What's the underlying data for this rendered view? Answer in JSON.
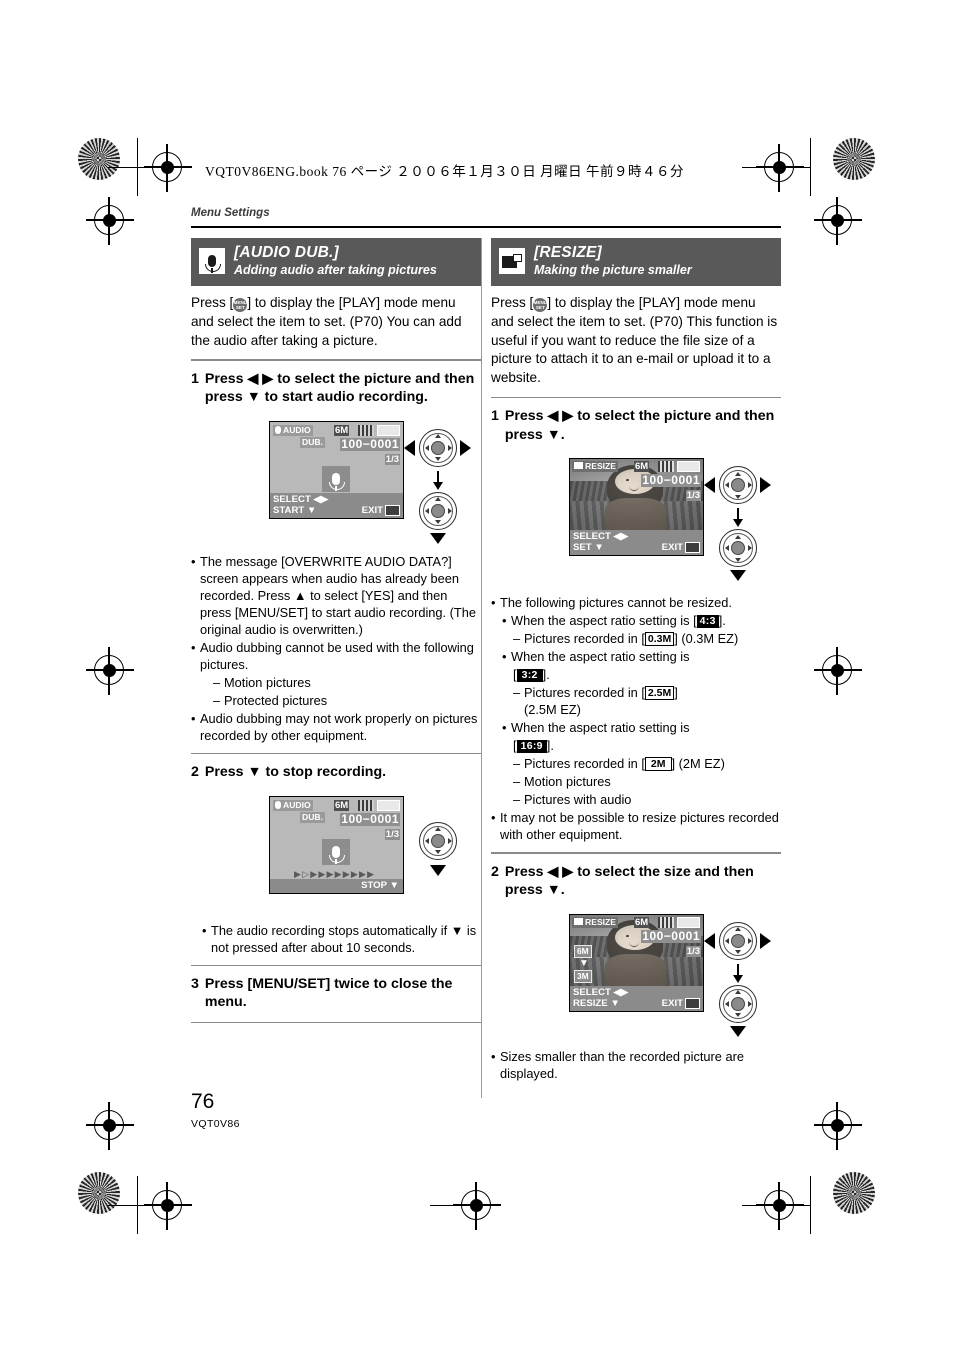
{
  "print_header": "VQT0V86ENG.book   76 ページ   ２００６年１月３０日   月曜日   午前９時４６分",
  "running_head": "Menu Settings",
  "footer": {
    "page_number": "76",
    "doc_code": "VQT0V86"
  },
  "left_column": {
    "banner": {
      "icon": "microphone-icon",
      "title": "[AUDIO DUB.]",
      "subtitle": "Adding audio after taking pictures"
    },
    "intro": {
      "p1_before": "Press [",
      "p1_after": "] to display the [PLAY] mode menu and select the item to set. (P70) You can add the audio after taking a picture.",
      "menu_icon_top": "MENU",
      "menu_icon_bottom": "SET"
    },
    "step1": {
      "num": "1",
      "text": "Press ◀ ▶ to select the picture and then press ▼ to start audio recording."
    },
    "screen1": {
      "label_line1": "AUDIO",
      "label_line2": "DUB.",
      "resolution": "6M",
      "file_number": "100−0001",
      "counter": "1/3",
      "foot_left_top": "SELECT ◀▶",
      "foot_left_bottom": "START ▼",
      "foot_right": "EXIT"
    },
    "notes1": [
      "The message [OVERWRITE AUDIO DATA?] screen appears when audio has already been recorded. Press ▲ to select [YES] and then press [MENU/SET] to start audio recording. (The original audio is overwritten.)",
      "Audio dubbing cannot be used with the following pictures.",
      "Audio dubbing may not work properly on pictures recorded by other equipment."
    ],
    "notes1_sub": [
      "Motion pictures",
      "Protected pictures"
    ],
    "step2": {
      "num": "2",
      "text": "Press ▼ to stop recording."
    },
    "screen2": {
      "label_line1": "AUDIO",
      "label_line2": "DUB.",
      "resolution": "6M",
      "file_number": "100−0001",
      "counter": "1/3",
      "progress": "▶▷▶▶▶▶▶▶▶▶",
      "foot_right": "STOP ▼"
    },
    "notes2": [
      "The audio recording stops automatically if ▼ is not pressed after about 10 seconds."
    ],
    "step3": {
      "num": "3",
      "text": "Press [MENU/SET] twice to close the menu."
    }
  },
  "right_column": {
    "banner": {
      "icon": "resize-icon",
      "title": "[RESIZE]",
      "subtitle": "Making the picture smaller"
    },
    "intro": {
      "p1_before": "Press [",
      "p1_after": "] to display the [PLAY] mode menu and select the item to set. (P70) This function is useful if you want to reduce the file size of a picture to attach it to an e-mail or upload it to a website.",
      "menu_icon_top": "MENU",
      "menu_icon_bottom": "SET"
    },
    "step1": {
      "num": "1",
      "text": "Press ◀ ▶ to select the picture and then press ▼."
    },
    "screen1": {
      "label": "RESIZE",
      "resolution": "6M",
      "file_number": "100−0001",
      "counter": "1/3",
      "foot_left_top": "SELECT ◀▶",
      "foot_left_bottom": "SET ▼",
      "foot_right": "EXIT"
    },
    "notes1": {
      "lead": "The following pictures cannot be resized.",
      "case1_before": "When the aspect ratio setting is [",
      "case1_chip": "4:3",
      "case1_after": "].",
      "case1_sub_before": "Pictures recorded in [",
      "case1_sub_chip": "0.3M",
      "case1_sub_after": "] (0.3M EZ)",
      "case2_before": "When the aspect ratio setting is",
      "case2_chip": "3:2",
      "case2_bracket_open": "[",
      "case2_bracket_close": "].",
      "case2_sub_before": "Pictures recorded in [",
      "case2_sub_chip": "2.5M",
      "case2_sub_after": "]",
      "case2_sub_line2": "(2.5M EZ)",
      "case3_before": "When the aspect ratio setting is",
      "case3_chip": "16:9",
      "case3_bracket_open": "[",
      "case3_bracket_close": "].",
      "case3_sub_before": "Pictures recorded in [",
      "case3_sub_chip": "2M",
      "case3_sub_after": "] (2M EZ)",
      "case3_sub_line2": "Motion pictures",
      "case3_sub_line3": "Pictures with audio",
      "tail": "It may not be possible to resize pictures recorded with other equipment."
    },
    "step2": {
      "num": "2",
      "text": "Press ◀ ▶ to select the size and then press ▼."
    },
    "screen2": {
      "label": "RESIZE",
      "resolution": "6M",
      "file_number": "100−0001",
      "counter": "1/3",
      "size_top": "6M",
      "size_bottom": "3M",
      "foot_left_top": "SELECT ◀▶",
      "foot_left_bottom": "RESIZE ▼",
      "foot_right": "EXIT"
    },
    "notes2": [
      "Sizes smaller than the recorded picture are displayed."
    ]
  }
}
